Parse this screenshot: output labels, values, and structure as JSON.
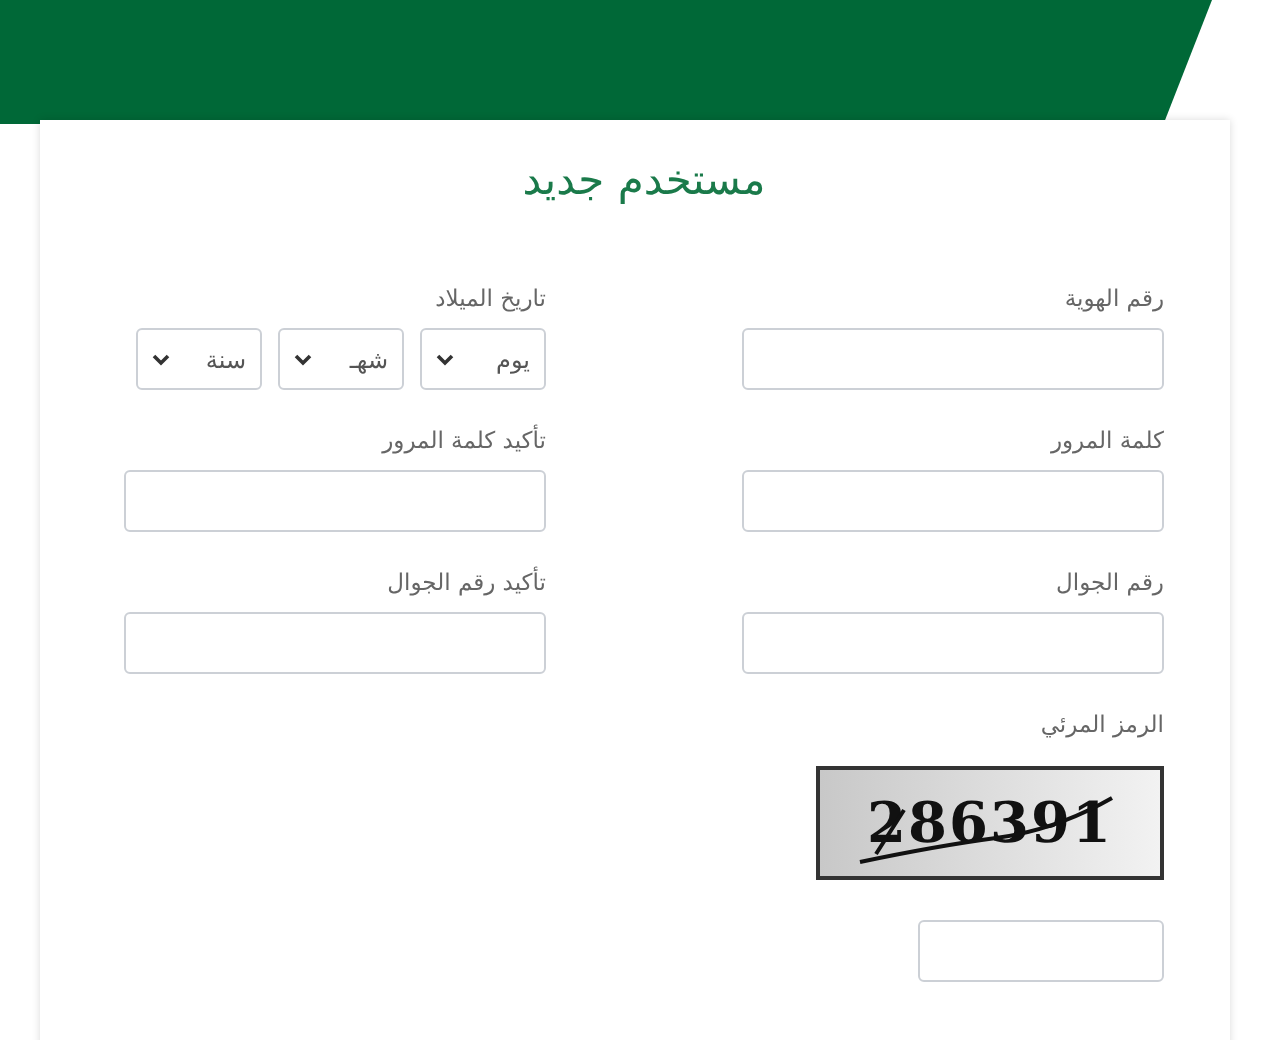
{
  "title": "مستخدم جديد",
  "fields": [
    {
      "kind": "text",
      "label": "رقم الهوية"
    },
    {
      "kind": "date",
      "label": "تاريخ الميلاد",
      "selects": [
        "يوم",
        "شهـ",
        "سنة"
      ]
    },
    {
      "kind": "text",
      "label": "كلمة المرور"
    },
    {
      "kind": "text",
      "label": "تأكيد كلمة المرور"
    },
    {
      "kind": "text",
      "label": "رقم الجوال"
    },
    {
      "kind": "text",
      "label": "تأكيد رقم الجوال"
    },
    {
      "kind": "captcha",
      "label": "الرمز المرئي",
      "code": "286391"
    }
  ]
}
